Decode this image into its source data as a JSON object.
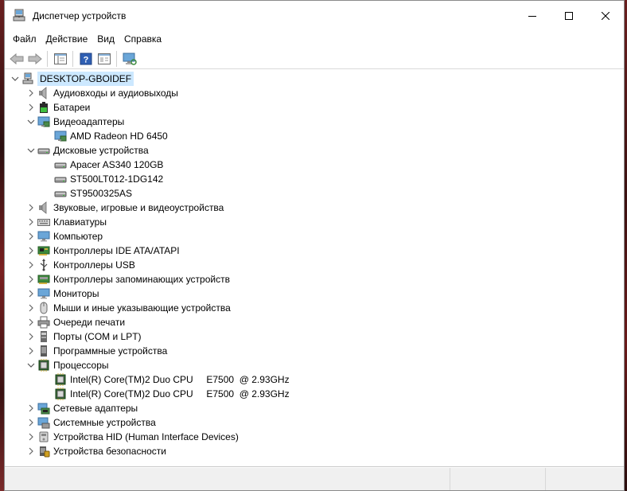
{
  "window": {
    "title": "Диспетчер устройств"
  },
  "menu": [
    "Файл",
    "Действие",
    "Вид",
    "Справка"
  ],
  "tree": {
    "root": "DESKTOP-GBOIDEF",
    "categories": [
      {
        "label": "Аудиовходы и аудиовыходы",
        "icon": "speaker-icon",
        "expanded": false,
        "children": []
      },
      {
        "label": "Батареи",
        "icon": "battery-icon",
        "expanded": false,
        "children": []
      },
      {
        "label": "Видеоадаптеры",
        "icon": "display-adapter-icon",
        "expanded": true,
        "children": [
          "AMD Radeon HD 6450"
        ]
      },
      {
        "label": "Дисковые устройства",
        "icon": "disk-drive-icon",
        "expanded": true,
        "children": [
          "Apacer AS340 120GB",
          "ST500LT012-1DG142",
          "ST9500325AS"
        ]
      },
      {
        "label": "Звуковые, игровые и видеоустройства",
        "icon": "speaker-icon",
        "expanded": false,
        "children": []
      },
      {
        "label": "Клавиатуры",
        "icon": "keyboard-icon",
        "expanded": false,
        "children": []
      },
      {
        "label": "Компьютер",
        "icon": "monitor-icon",
        "expanded": false,
        "children": []
      },
      {
        "label": "Контроллеры IDE ATA/ATAPI",
        "icon": "controller-card-icon",
        "expanded": false,
        "children": []
      },
      {
        "label": "Контроллеры USB",
        "icon": "usb-icon",
        "expanded": false,
        "children": []
      },
      {
        "label": "Контроллеры запоминающих устройств",
        "icon": "storage-controller-icon",
        "expanded": false,
        "children": []
      },
      {
        "label": "Мониторы",
        "icon": "monitor-icon",
        "expanded": false,
        "children": []
      },
      {
        "label": "Мыши и иные указывающие устройства",
        "icon": "mouse-icon",
        "expanded": false,
        "children": []
      },
      {
        "label": "Очереди печати",
        "icon": "printer-icon",
        "expanded": false,
        "children": []
      },
      {
        "label": "Порты (COM и LPT)",
        "icon": "port-icon",
        "expanded": false,
        "children": []
      },
      {
        "label": "Программные устройства",
        "icon": "software-device-icon",
        "expanded": false,
        "children": []
      },
      {
        "label": "Процессоры",
        "icon": "cpu-icon",
        "expanded": true,
        "children": [
          "Intel(R) Core(TM)2 Duo CPU     E7500  @ 2.93GHz",
          "Intel(R) Core(TM)2 Duo CPU     E7500  @ 2.93GHz"
        ]
      },
      {
        "label": "Сетевые адаптеры",
        "icon": "network-adapter-icon",
        "expanded": false,
        "children": []
      },
      {
        "label": "Системные устройства",
        "icon": "system-device-icon",
        "expanded": false,
        "children": []
      },
      {
        "label": "Устройства HID (Human Interface Devices)",
        "icon": "hid-icon",
        "expanded": false,
        "children": []
      },
      {
        "label": "Устройства безопасности",
        "icon": "security-device-icon",
        "expanded": false,
        "children": []
      }
    ]
  },
  "colors": {
    "selection": "#cce8ff",
    "chevron": "#666666"
  }
}
